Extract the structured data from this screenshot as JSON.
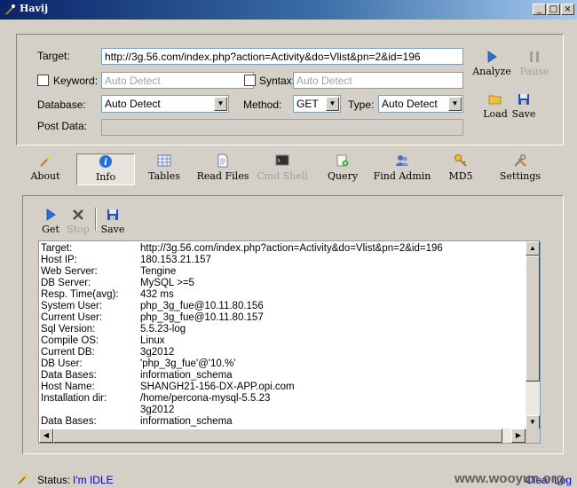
{
  "window": {
    "title": "Havij",
    "controls": [
      "minimize-icon",
      "maximize-icon",
      "close-icon"
    ]
  },
  "form": {
    "target_label": "Target:",
    "target_value": "http://3g.56.com/index.php?action=Activity&do=Vlist&pn=2&id=196",
    "keyword_label": "Keyword:",
    "keyword_value": "Auto Detect",
    "syntax_label": "Syntax:",
    "syntax_value": "Auto Detect",
    "database_label": "Database:",
    "database_value": "Auto Detect",
    "method_label": "Method:",
    "method_value": "GET",
    "type_label": "Type:",
    "type_value": "Auto Detect",
    "postdata_label": "Post Data:",
    "postdata_value": ""
  },
  "actions": {
    "analyze": "Analyze",
    "pause": "Pause",
    "load": "Load",
    "save": "Save"
  },
  "toolbar": [
    {
      "label": "About",
      "icon": "wand-icon"
    },
    {
      "label": "Info",
      "icon": "info-icon"
    },
    {
      "label": "Tables",
      "icon": "table-icon"
    },
    {
      "label": "Read Files",
      "icon": "file-icon"
    },
    {
      "label": "Cmd Shell",
      "icon": "terminal-icon"
    },
    {
      "label": "Query",
      "icon": "query-icon"
    },
    {
      "label": "Find Admin",
      "icon": "users-icon"
    },
    {
      "label": "MD5",
      "icon": "key-icon"
    },
    {
      "label": "Settings",
      "icon": "tools-icon"
    }
  ],
  "info_panel": {
    "get": "Get",
    "stop": "Stop",
    "save": "Save",
    "rows": [
      {
        "key": "Target:",
        "value": "http://3g.56.com/index.php?action=Activity&do=Vlist&pn=2&id=196"
      },
      {
        "key": "Host IP:",
        "value": "180.153.21.157"
      },
      {
        "key": "Web Server:",
        "value": "Tengine"
      },
      {
        "key": "DB Server:",
        "value": "MySQL >=5"
      },
      {
        "key": "Resp. Time(avg):",
        "value": "432 ms"
      },
      {
        "key": "System User:",
        "value": "php_3g_fue@10.11.80.156"
      },
      {
        "key": "Current User:",
        "value": "php_3g_fue@10.11.80.157"
      },
      {
        "key": "Sql Version:",
        "value": "5.5.23-log"
      },
      {
        "key": "Compile OS:",
        "value": "Linux"
      },
      {
        "key": "Current DB:",
        "value": "3g2012"
      },
      {
        "key": "DB User:",
        "value": "'php_3g_fue'@'10.%'"
      },
      {
        "key": "Data Bases:",
        "value": "information_schema"
      },
      {
        "key": "Host Name:",
        "value": "SHANGH21-156-DX-APP.opi.com"
      },
      {
        "key": "Installation dir:",
        "value": "/home/percona-mysql-5.5.23"
      },
      {
        "key": "",
        "value": "3g2012"
      },
      {
        "key": "Data Bases:",
        "value": "information_schema"
      }
    ]
  },
  "status": {
    "label": "Status:",
    "value": "I'm IDLE",
    "clear_log": "Clear Log",
    "watermark": "www.wooyun.org"
  },
  "colors": {
    "titlebar_start": "#0a246a",
    "status_value": "#0000c0",
    "analyze_icon": "#2a6fd6"
  }
}
